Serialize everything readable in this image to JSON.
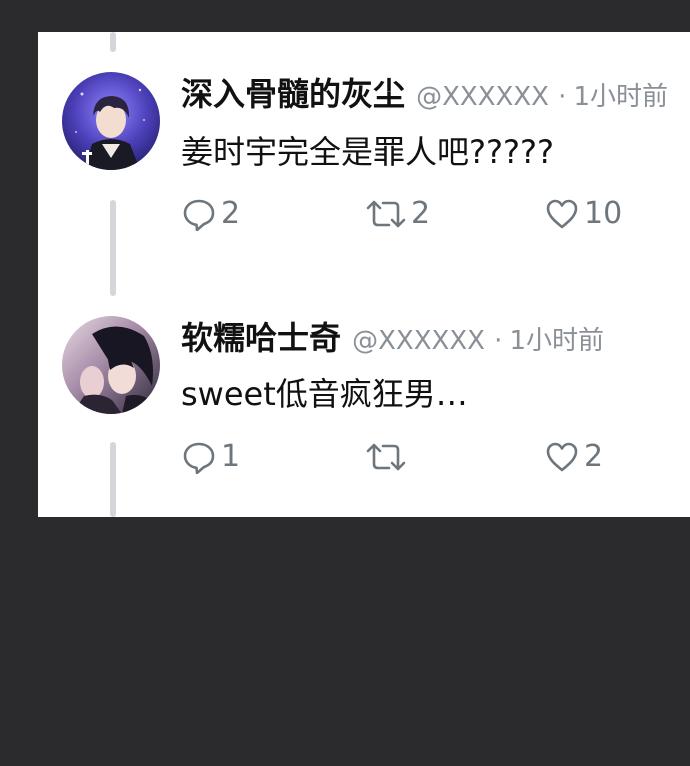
{
  "tweets": [
    {
      "author_name": "深入骨髓的灰尘",
      "handle": "@XXXXXX",
      "separator": "·",
      "time": "1小时前",
      "text": "姜时宇完全是罪人吧?????",
      "replies": "2",
      "retweets": "2",
      "likes": "10"
    },
    {
      "author_name": "软糯哈士奇",
      "handle": "@XXXXXX",
      "separator": "·",
      "time": "1小时前",
      "text": "sweet低音疯狂男…",
      "replies": "1",
      "retweets": "",
      "likes": "2"
    }
  ],
  "icons": {
    "reply": "speech-bubble-icon",
    "retweet": "retweet-arrows-icon",
    "like": "heart-icon"
  },
  "colors": {
    "background": "#2b2b2d",
    "card": "#ffffff",
    "text": "#111111",
    "meta": "#8a9097",
    "icon": "#6e767d",
    "thread_line": "#d4d6d9"
  }
}
